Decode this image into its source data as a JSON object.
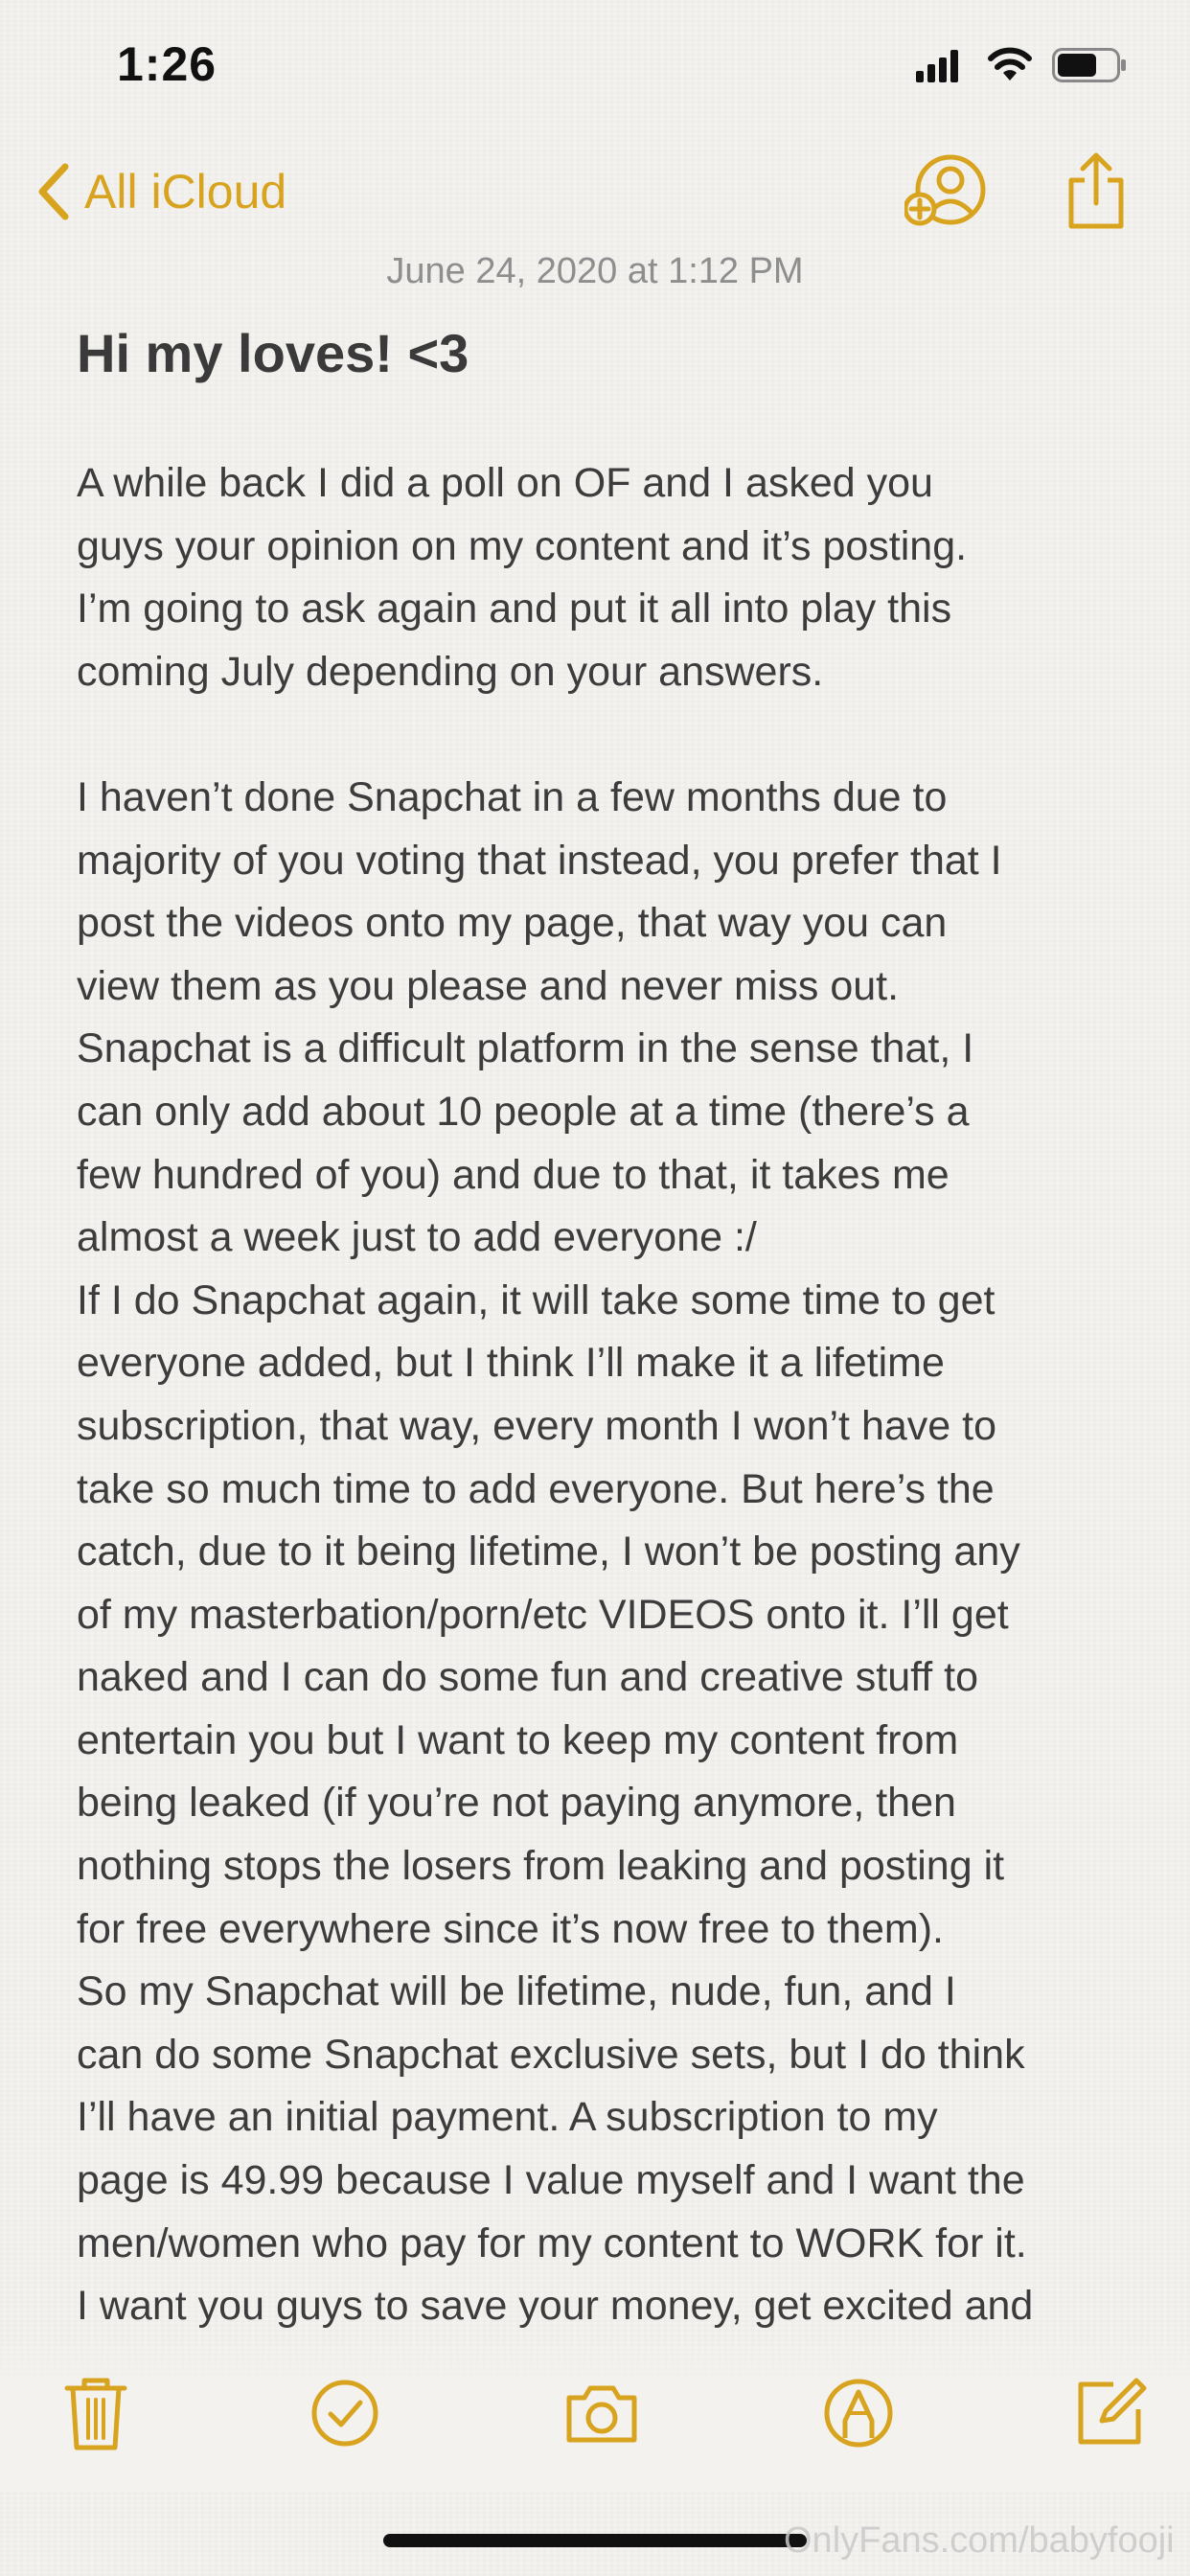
{
  "status_bar": {
    "time": "1:26"
  },
  "nav": {
    "back_label": "All iCloud"
  },
  "note": {
    "date": "June 24, 2020 at 1:12 PM",
    "title": "Hi my loves! <3",
    "body": "   A while back I did a poll on OF and I asked you\nguys your opinion on my content and it’s posting.\nI’m going to ask again and put it all into play this\ncoming July depending on your answers.\n\n   I haven’t done Snapchat in a few months due to\nmajority of you voting that instead, you prefer that I\npost the videos onto my page, that way you can\nview them as you please and never miss out.\n   Snapchat is a difficult platform in the sense that, I\ncan only add about 10 people at a time (there’s a\nfew hundred of you) and due to that, it takes me\nalmost a week just to add everyone :/\n   If I do Snapchat again, it will take some time to get\neveryone added, but I think I’ll make it a lifetime\nsubscription, that way, every month I won’t have to\ntake so much time to add everyone. But here’s the\ncatch, due to it being lifetime, I won’t be posting any\nof my masterbation/porn/etc VIDEOS onto it. I’ll get\nnaked and I can do some fun and creative stuff to\nentertain you but I want to keep my content from\nbeing leaked (if you’re not paying anymore, then\nnothing stops the losers from leaking and posting it\nfor free everywhere since it’s now free to them).\n  So my Snapchat will be lifetime, nude, fun, and I\ncan do some Snapchat exclusive sets, but I do think\nI’ll have an initial payment. A subscription to my\npage is 49.99 because I value myself and I want the\nmen/women who pay for my content to WORK for it.\nI want you guys to save your money, get excited and"
  },
  "toolbar": {
    "icons": [
      "trash-icon",
      "checklist-icon",
      "camera-icon",
      "markup-icon",
      "compose-icon"
    ]
  },
  "watermark": "OnlyFans.com/babyfooji",
  "colors": {
    "accent": "#d8a41f",
    "background": "#f3f2ef",
    "text": "#3c3c3c",
    "date_text": "#8e8e8e"
  }
}
